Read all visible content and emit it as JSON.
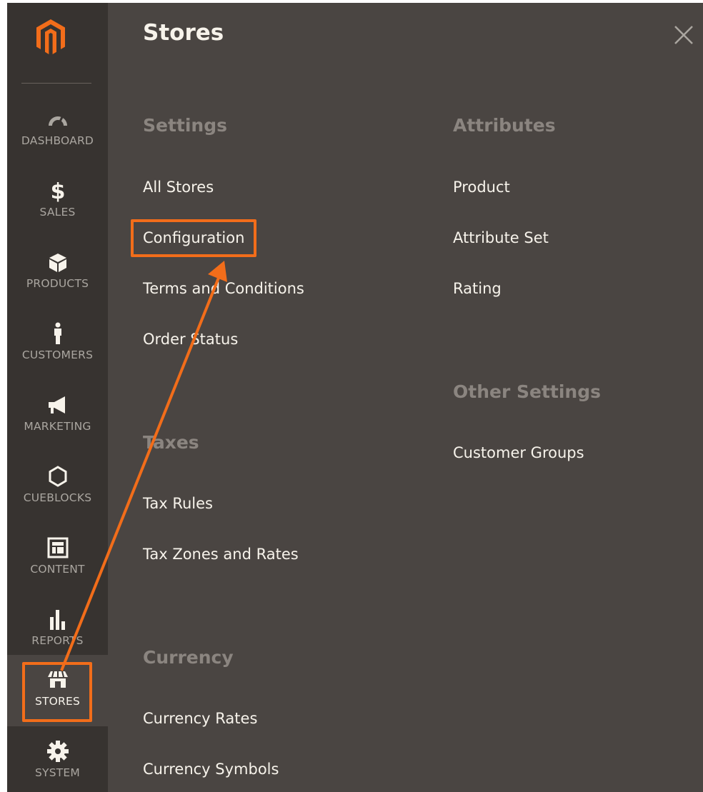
{
  "nav": {
    "items": [
      {
        "label": "DASHBOARD",
        "icon": "dashboard-icon"
      },
      {
        "label": "SALES",
        "icon": "dollar-icon"
      },
      {
        "label": "PRODUCTS",
        "icon": "cube-icon"
      },
      {
        "label": "CUSTOMERS",
        "icon": "person-icon"
      },
      {
        "label": "MARKETING",
        "icon": "megaphone-icon"
      },
      {
        "label": "CUEBLOCKS",
        "icon": "hexagon-icon"
      },
      {
        "label": "CONTENT",
        "icon": "layout-icon"
      },
      {
        "label": "REPORTS",
        "icon": "bar-chart-icon"
      },
      {
        "label": "STORES",
        "icon": "storefront-icon",
        "active": true
      },
      {
        "label": "SYSTEM",
        "icon": "gear-icon"
      }
    ]
  },
  "panel": {
    "title": "Stores",
    "groups": {
      "settings": {
        "title": "Settings",
        "links": [
          "All Stores",
          "Configuration",
          "Terms and Conditions",
          "Order Status"
        ]
      },
      "taxes": {
        "title": "Taxes",
        "links": [
          "Tax Rules",
          "Tax Zones and Rates"
        ]
      },
      "currency": {
        "title": "Currency",
        "links": [
          "Currency Rates",
          "Currency Symbols"
        ]
      },
      "attributes": {
        "title": "Attributes",
        "links": [
          "Product",
          "Attribute Set",
          "Rating"
        ]
      },
      "other": {
        "title": "Other Settings",
        "links": [
          "Customer Groups"
        ]
      }
    }
  },
  "colors": {
    "panel_bg": "#4a4542",
    "sidebar_bg": "#373330",
    "highlight": "#f26d1a",
    "logo": "#f26d1a"
  }
}
